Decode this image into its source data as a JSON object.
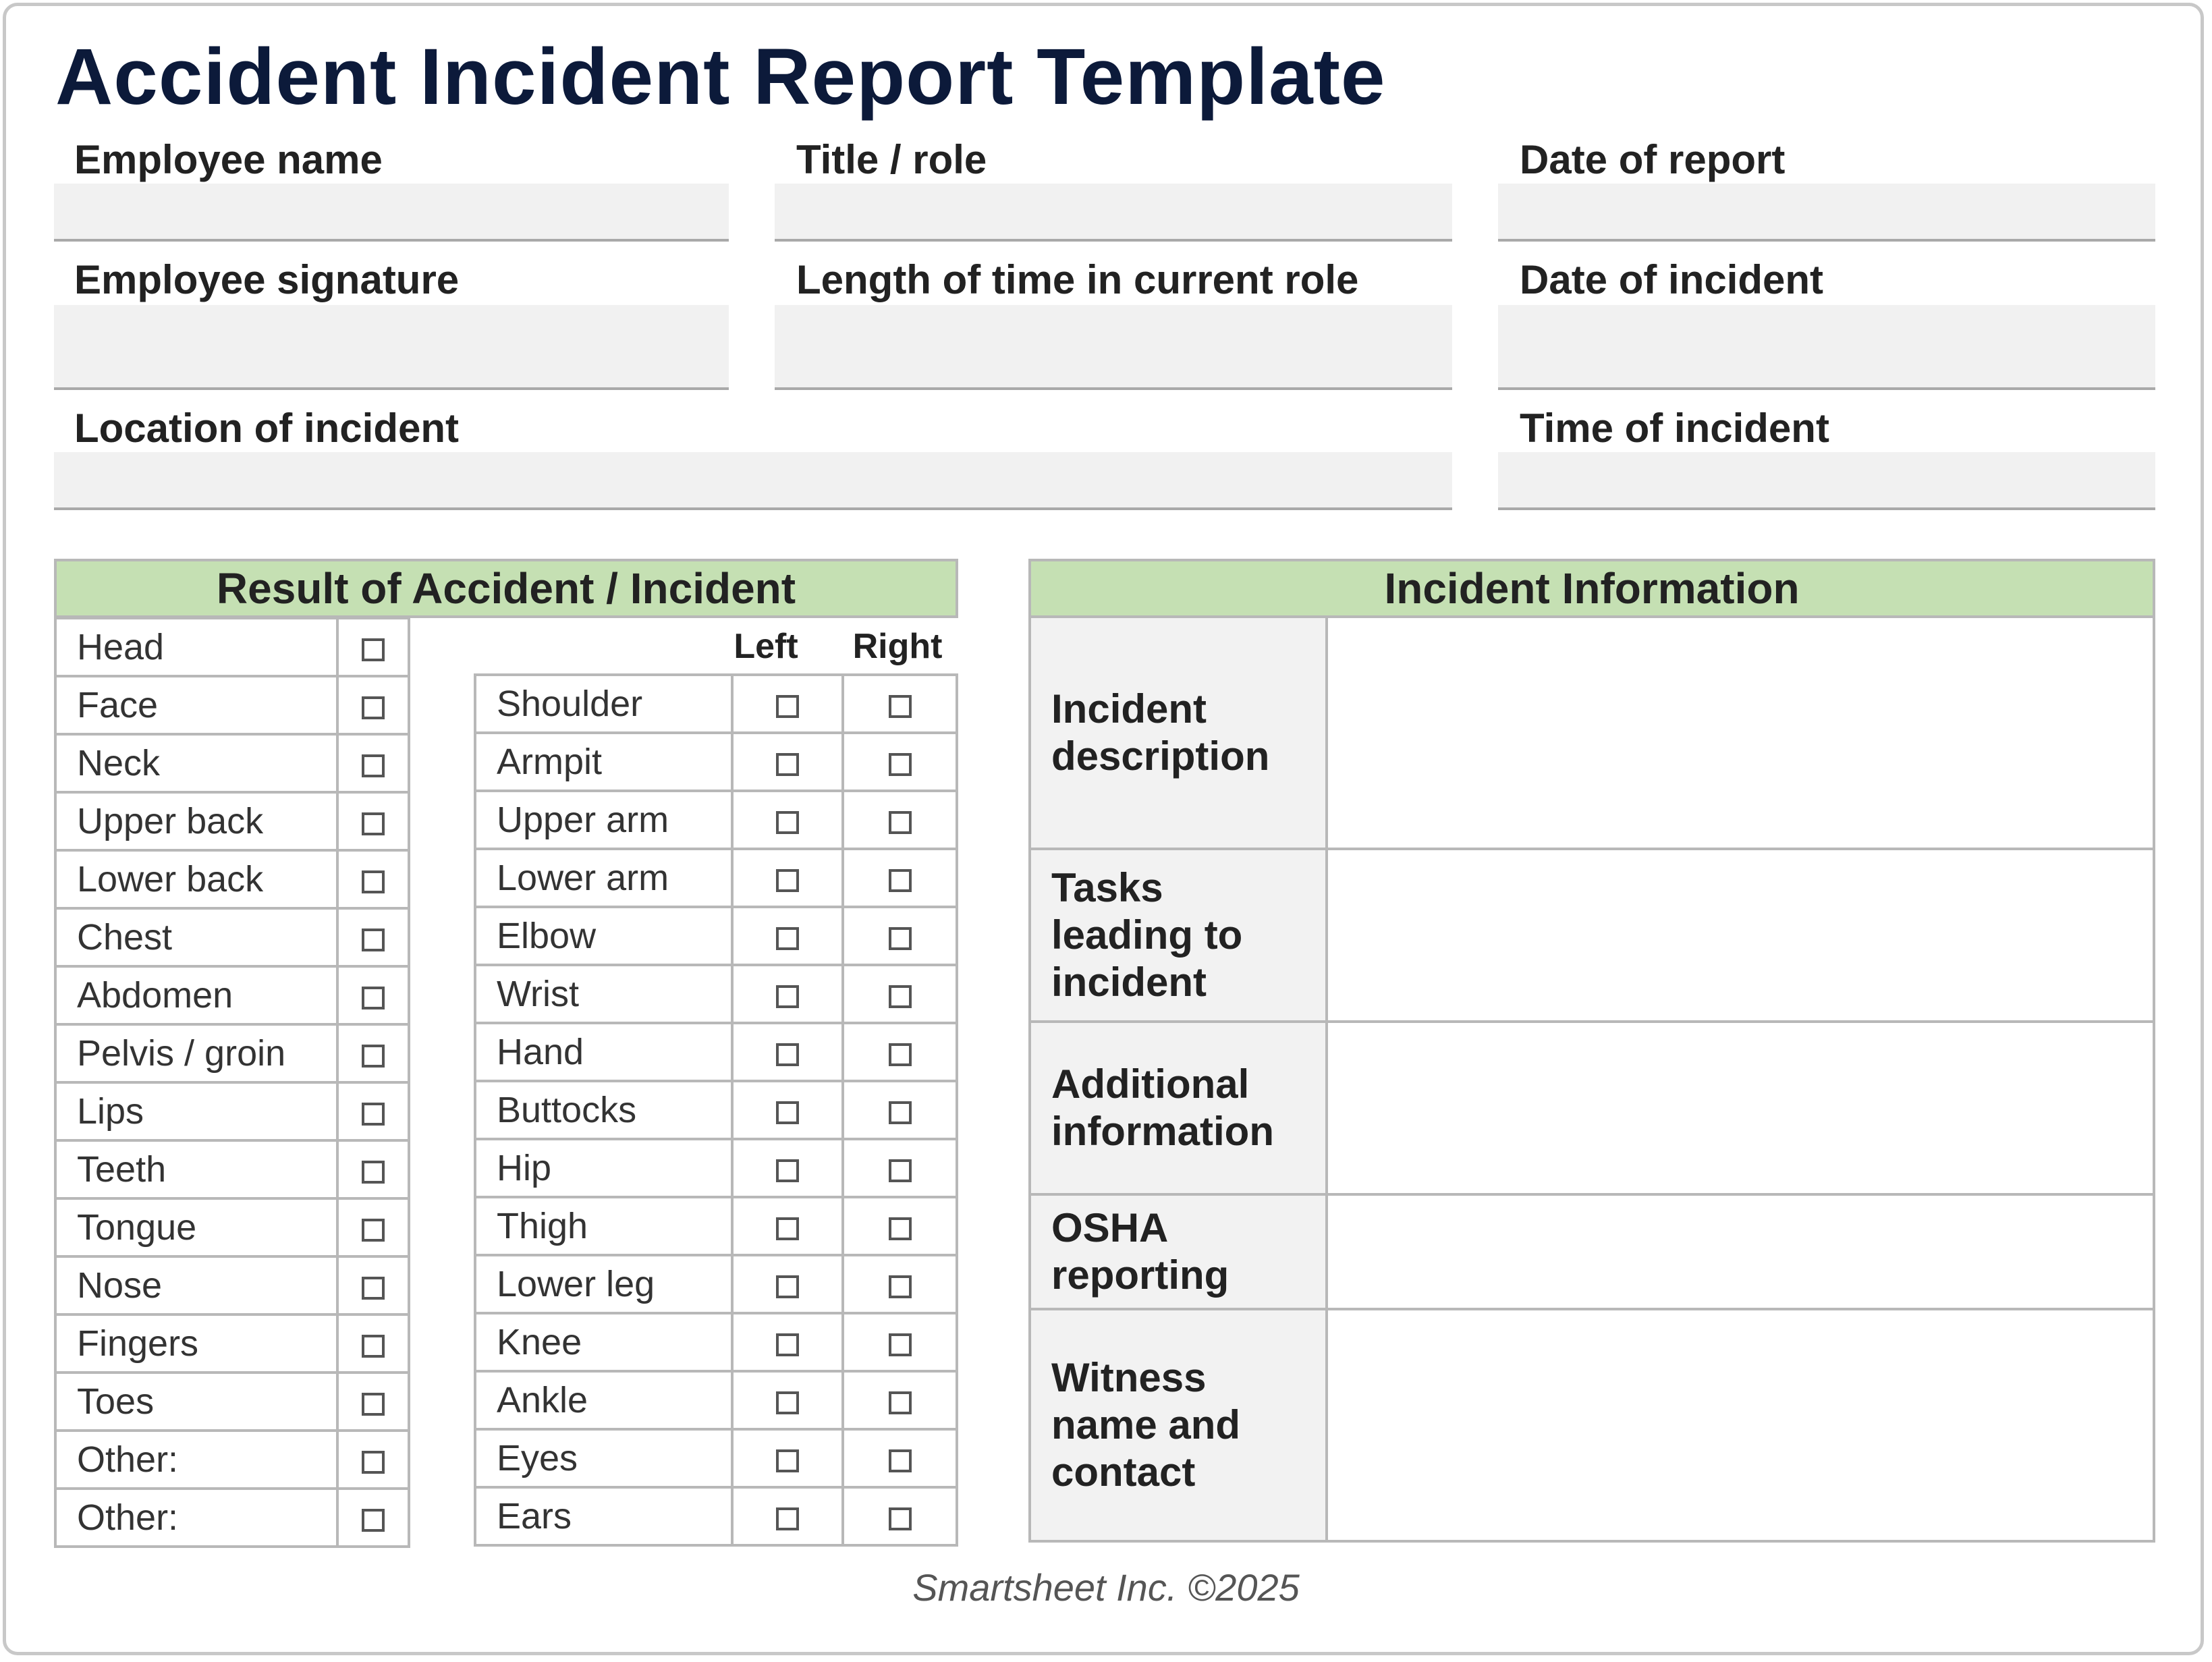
{
  "title": "Accident Incident Report Template",
  "fields": {
    "employee_name": {
      "label": "Employee name",
      "value": ""
    },
    "title_role": {
      "label": "Title / role",
      "value": ""
    },
    "date_of_report": {
      "label": "Date of report",
      "value": ""
    },
    "employee_signature": {
      "label": "Employee signature",
      "value": ""
    },
    "length_of_time": {
      "label": "Length of time in current role",
      "value": ""
    },
    "date_of_incident": {
      "label": "Date of incident",
      "value": ""
    },
    "location_of_incident": {
      "label": "Location of incident",
      "value": ""
    },
    "time_of_incident": {
      "label": "Time of incident",
      "value": ""
    }
  },
  "result": {
    "header": "Result of Accident / Incident",
    "left_col_label": "Left",
    "right_col_label": "Right",
    "single_items": [
      "Head",
      "Face",
      "Neck",
      "Upper back",
      "Lower back",
      "Chest",
      "Abdomen",
      "Pelvis / groin",
      "Lips",
      "Teeth",
      "Tongue",
      "Nose",
      "Fingers",
      "Toes",
      "Other:",
      "Other:"
    ],
    "paired_items": [
      "Shoulder",
      "Armpit",
      "Upper arm",
      "Lower arm",
      "Elbow",
      "Wrist",
      "Hand",
      "Buttocks",
      "Hip",
      "Thigh",
      "Lower leg",
      "Knee",
      "Ankle",
      "Eyes",
      "Ears"
    ]
  },
  "info": {
    "header": "Incident Information",
    "rows": [
      {
        "label": "Incident\ndescription",
        "value": ""
      },
      {
        "label": "Tasks\nleading to\nincident",
        "value": ""
      },
      {
        "label": "Additional\ninformation",
        "value": ""
      },
      {
        "label": "OSHA\nreporting",
        "value": ""
      },
      {
        "label": "Witness\nname and\ncontact",
        "value": ""
      }
    ]
  },
  "colors": {
    "section_header": "#c5e0b3",
    "field_background": "#f1f1f1",
    "title": "#0c1a3a"
  },
  "footer": "Smartsheet Inc. ©2025"
}
